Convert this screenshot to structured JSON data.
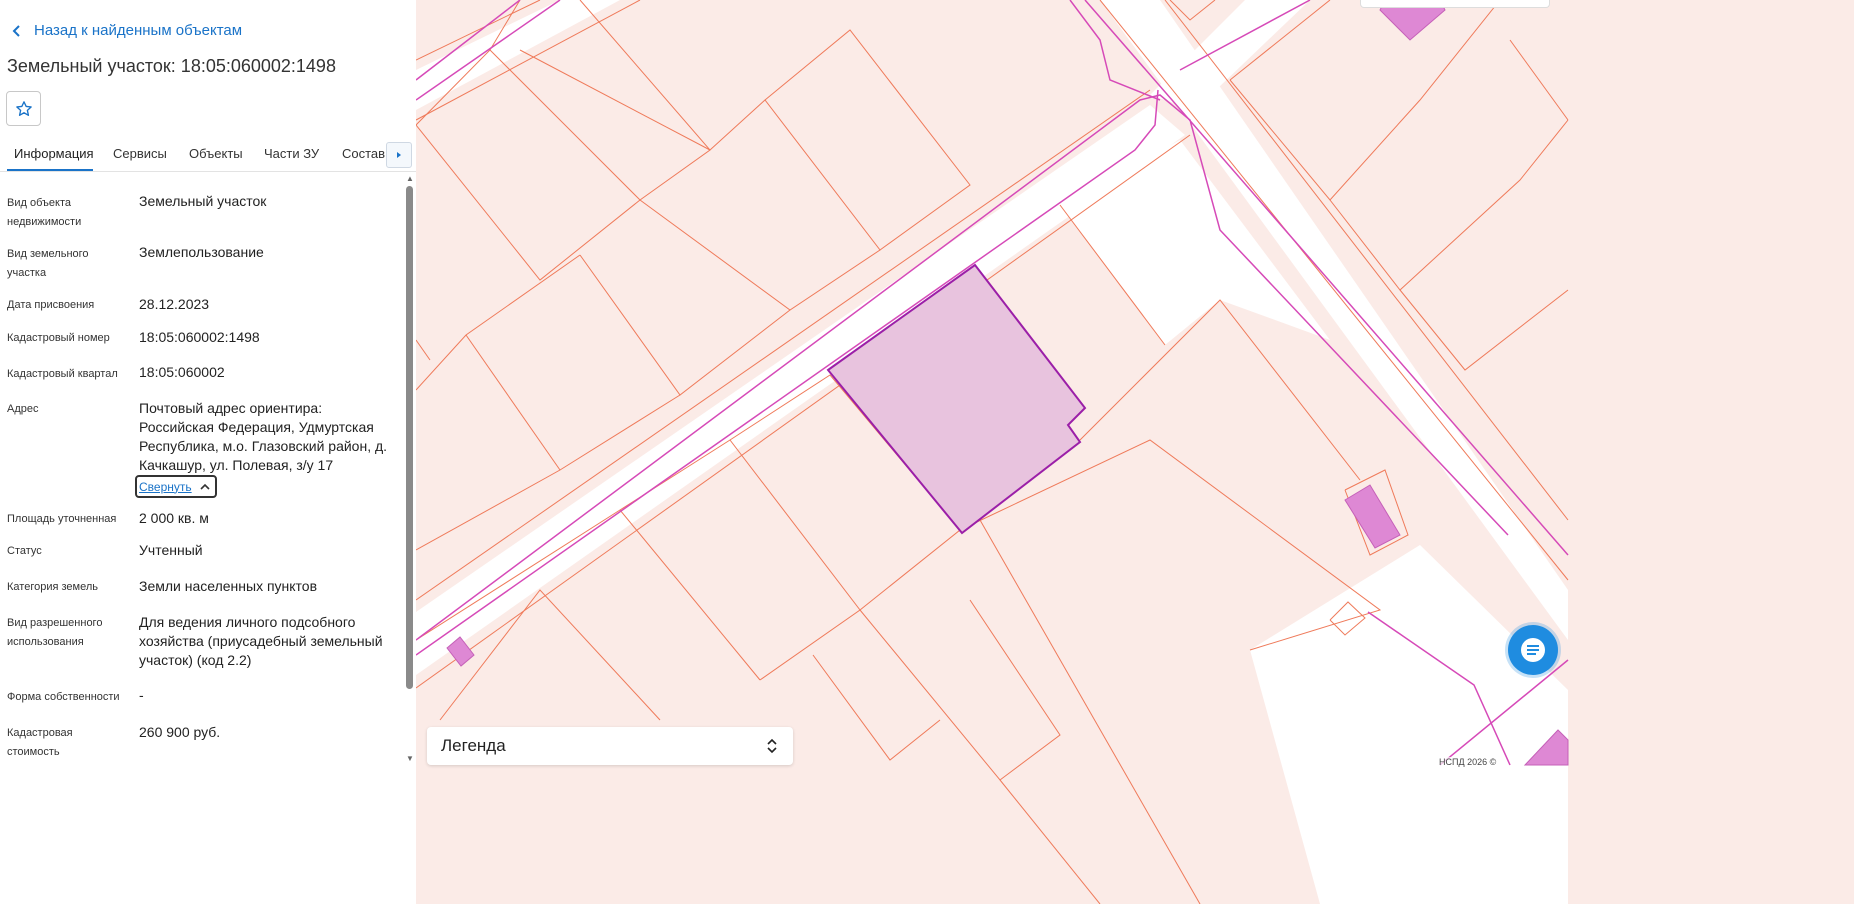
{
  "back_link": "Назад к найденным объектам",
  "title": "Земельный участок: 18:05:060002:1498",
  "tabs": [
    {
      "label": "Информация"
    },
    {
      "label": "Сервисы"
    },
    {
      "label": "Объекты"
    },
    {
      "label": "Части ЗУ"
    },
    {
      "label": "Состав"
    }
  ],
  "info": [
    {
      "label": "Вид объекта недвижимости",
      "value": "Земельный участок"
    },
    {
      "label": "Вид земельного участка",
      "value": "Землепользование"
    },
    {
      "label": "Дата присвоения",
      "value": "28.12.2023"
    },
    {
      "label": "Кадастровый номер",
      "value": "18:05:060002:1498"
    },
    {
      "label": "Кадастровый квартал",
      "value": "18:05:060002"
    },
    {
      "label": "Адрес",
      "value": "Почтовый адрес ориентира: Российская Федерация, Удмуртская Республика, м.о. Глазовский район, д. Качкашур, ул. Полевая, з/у 17"
    },
    {
      "label": "Площадь уточненная",
      "value": "2 000 кв. м"
    },
    {
      "label": "Статус",
      "value": "Учтенный"
    },
    {
      "label": "Категория земель",
      "value": "Земли населенных пунктов"
    },
    {
      "label": "Вид разрешенного использования",
      "value": "Для ведения личного подсобного хозяйства (приусадебный земельный участок) (код 2.2)"
    },
    {
      "label": "Форма собственности",
      "value": "-"
    },
    {
      "label": "Кадастровая стоимость",
      "value": "260 900 руб."
    }
  ],
  "collapse_label": "Свернуть",
  "legend_label": "Легенда",
  "copyright": "НСПД 2026 ©",
  "colors": {
    "accent": "#1a73c8",
    "parcel_fill": "#fbebe7",
    "parcel_stroke": "#ef7a5a",
    "selected_fill": "#e8c3de",
    "selected_stroke": "#9b1fa8",
    "line_magenta": "#d64ab8",
    "building_fill": "#de88d4"
  },
  "icons": [
    "chevron-left-icon",
    "star-icon",
    "triangle-right-icon",
    "chevron-up-icon",
    "updown-chevron-icon",
    "chat-icon"
  ]
}
